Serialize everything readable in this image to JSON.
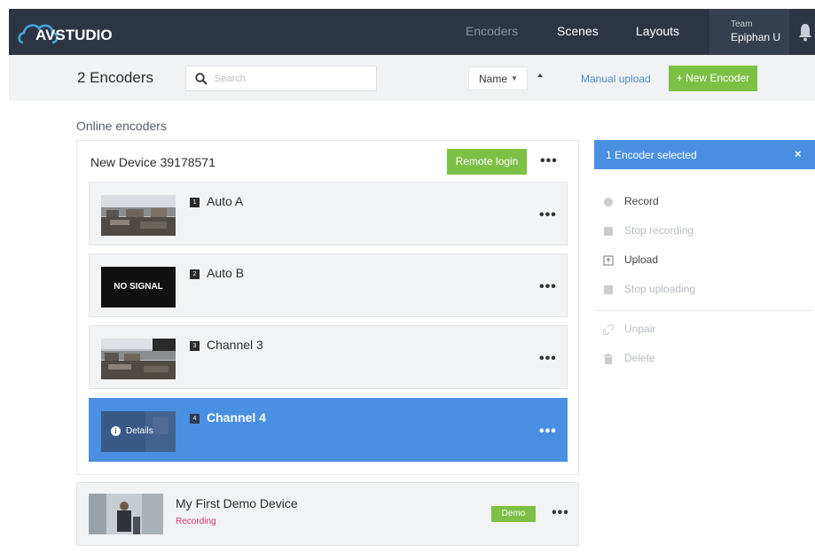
{
  "topbar": {
    "logo_text": "AVSTUDIO",
    "nav": [
      {
        "label": "Encoders",
        "active": true
      },
      {
        "label": "Scenes",
        "active": false
      },
      {
        "label": "Layouts",
        "active": false
      }
    ],
    "team_label": "Team",
    "team_name": "Epiphan U"
  },
  "toolbar": {
    "count_label": "2 Encoders",
    "search_placeholder": "Search",
    "search_value": "",
    "sort_label": "Name",
    "manual_upload": "Manual upload",
    "new_encoder": "+ New Encoder"
  },
  "section_title": "Online encoders",
  "device": {
    "name": "New Device 39178571",
    "remote_login": "Remote login",
    "more": "•••",
    "channels": [
      {
        "num": "1",
        "name": "Auto A",
        "thumb": "video",
        "selected": false
      },
      {
        "num": "2",
        "name": "Auto B",
        "thumb": "no-signal",
        "thumb_text": "NO SIGNAL",
        "selected": false
      },
      {
        "num": "3",
        "name": "Channel 3",
        "thumb": "video",
        "selected": false
      },
      {
        "num": "4",
        "name": "Channel 4",
        "thumb": "details",
        "thumb_text": "Details",
        "selected": true
      }
    ]
  },
  "demo_device": {
    "name": "My First Demo Device",
    "status": "Recording",
    "badge": "Demo",
    "more": "•••"
  },
  "selection_panel": {
    "title": "1 Encoder selected",
    "close": "×",
    "actions": [
      {
        "label": "Record",
        "icon": "record-icon",
        "enabled": true
      },
      {
        "label": "Stop recording",
        "icon": "stop-icon",
        "enabled": false
      },
      {
        "label": "Upload",
        "icon": "upload-icon",
        "enabled": true
      },
      {
        "label": "Stop uploading",
        "icon": "stop-icon",
        "enabled": false
      },
      {
        "label": "Unpair",
        "icon": "unlink-icon",
        "enabled": false
      },
      {
        "label": "Delete",
        "icon": "trash-icon",
        "enabled": false
      }
    ]
  },
  "colors": {
    "topbar": "#2d3545",
    "accent_green": "#7cc045",
    "accent_blue": "#4a90e2",
    "recording_red": "#e0306a"
  }
}
